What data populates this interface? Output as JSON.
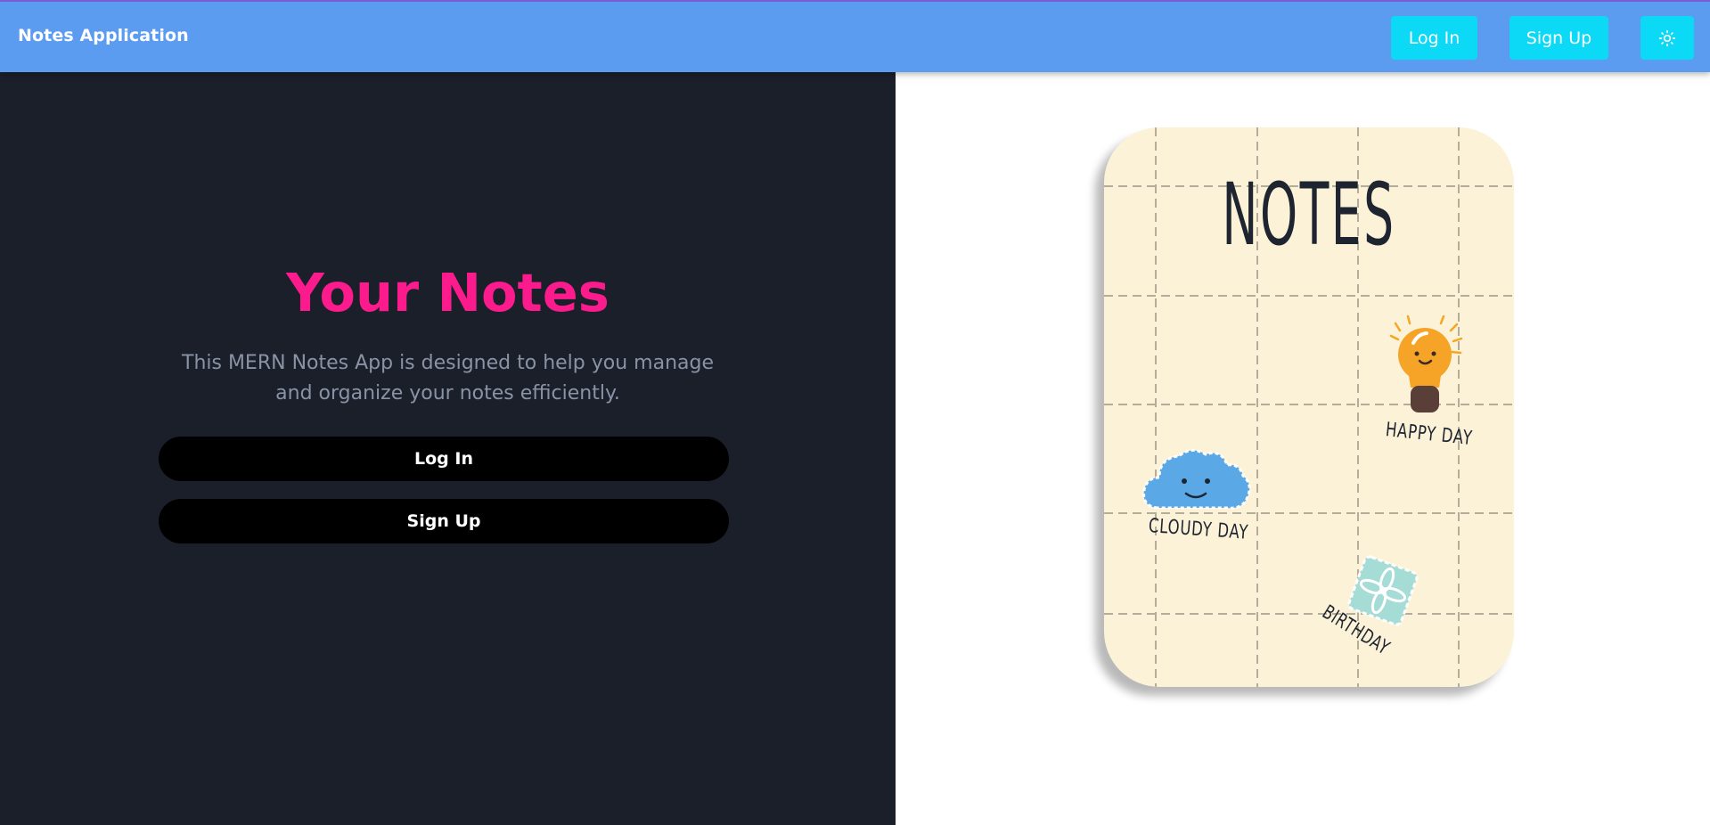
{
  "navbar": {
    "brand": "Notes Application",
    "login_label": "Log In",
    "signup_label": "Sign Up",
    "theme_icon": "sun-icon"
  },
  "hero": {
    "title": "Your Notes",
    "description": "This MERN Notes App is designed to help you manage and organize your notes efficiently.",
    "login_label": "Log In",
    "signup_label": "Sign Up"
  },
  "illustration": {
    "title": "NOTES",
    "stickers": [
      {
        "icon": "lightbulb-icon",
        "label": "HAPPY DAY"
      },
      {
        "icon": "cloud-icon",
        "label": "CLOUDY DAY"
      },
      {
        "icon": "gift-icon",
        "label": "BIRTHDAY"
      }
    ]
  },
  "colors": {
    "navbar": "#5b9cf0",
    "nav_button": "#0cd9f5",
    "title_accent": "#fc1b8d",
    "left_background": "#1b1f2a",
    "card_background": "#fbf2d8"
  }
}
